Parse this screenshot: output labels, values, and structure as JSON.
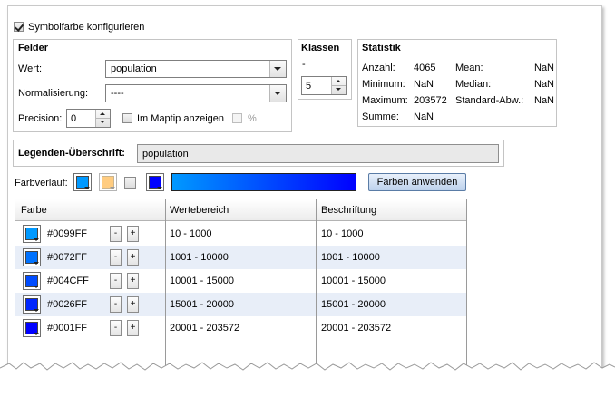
{
  "top": {
    "checkbox_label": "Symbolfarbe konfigurieren"
  },
  "felder": {
    "title": "Felder",
    "wert_label": "Wert:",
    "wert_value": "population",
    "norm_label": "Normalisierung:",
    "norm_value": "----",
    "precision_label": "Precision:",
    "precision_value": "0",
    "maptip_label": "Im Maptip anzeigen",
    "percent_label": "%"
  },
  "klassen": {
    "title": "Klassen",
    "dash": "-",
    "value": "5"
  },
  "statistik": {
    "title": "Statistik",
    "left": [
      {
        "label": "Anzahl:",
        "value": "4065"
      },
      {
        "label": "Minimum:",
        "value": "NaN"
      },
      {
        "label": "Maximum:",
        "value": "203572"
      },
      {
        "label": "Summe:",
        "value": "NaN"
      }
    ],
    "right": [
      {
        "label": "Mean:",
        "value": "NaN"
      },
      {
        "label": "Median:",
        "value": "NaN"
      },
      {
        "label": "Standard-Abw.:",
        "value": "NaN"
      }
    ]
  },
  "legend": {
    "label": "Legenden-Überschrift:",
    "value": "population"
  },
  "farbverlauf": {
    "label": "Farbverlauf:",
    "apply_label": "Farben anwenden",
    "start_color": "#0099FF",
    "mid_color": "#FFCC80",
    "end_color": "#0001FF"
  },
  "table": {
    "headers": [
      "Farbe",
      "Wertebereich",
      "Beschriftung"
    ],
    "rows": [
      {
        "color": "#0099FF",
        "minus": "-",
        "plus": "+",
        "range": "10 - 1000",
        "label": "10 - 1000"
      },
      {
        "color": "#0072FF",
        "minus": "-",
        "plus": "+",
        "range": "1001 - 10000",
        "label": "1001 - 10000"
      },
      {
        "color": "#004CFF",
        "minus": "-",
        "plus": "+",
        "range": "10001 - 15000",
        "label": "10001 - 15000"
      },
      {
        "color": "#0026FF",
        "minus": "-",
        "plus": "+",
        "range": "15001 - 20000",
        "label": "15001 - 20000"
      },
      {
        "color": "#0001FF",
        "minus": "-",
        "plus": "+",
        "range": "20001 - 203572",
        "label": "20001 - 203572"
      }
    ]
  }
}
